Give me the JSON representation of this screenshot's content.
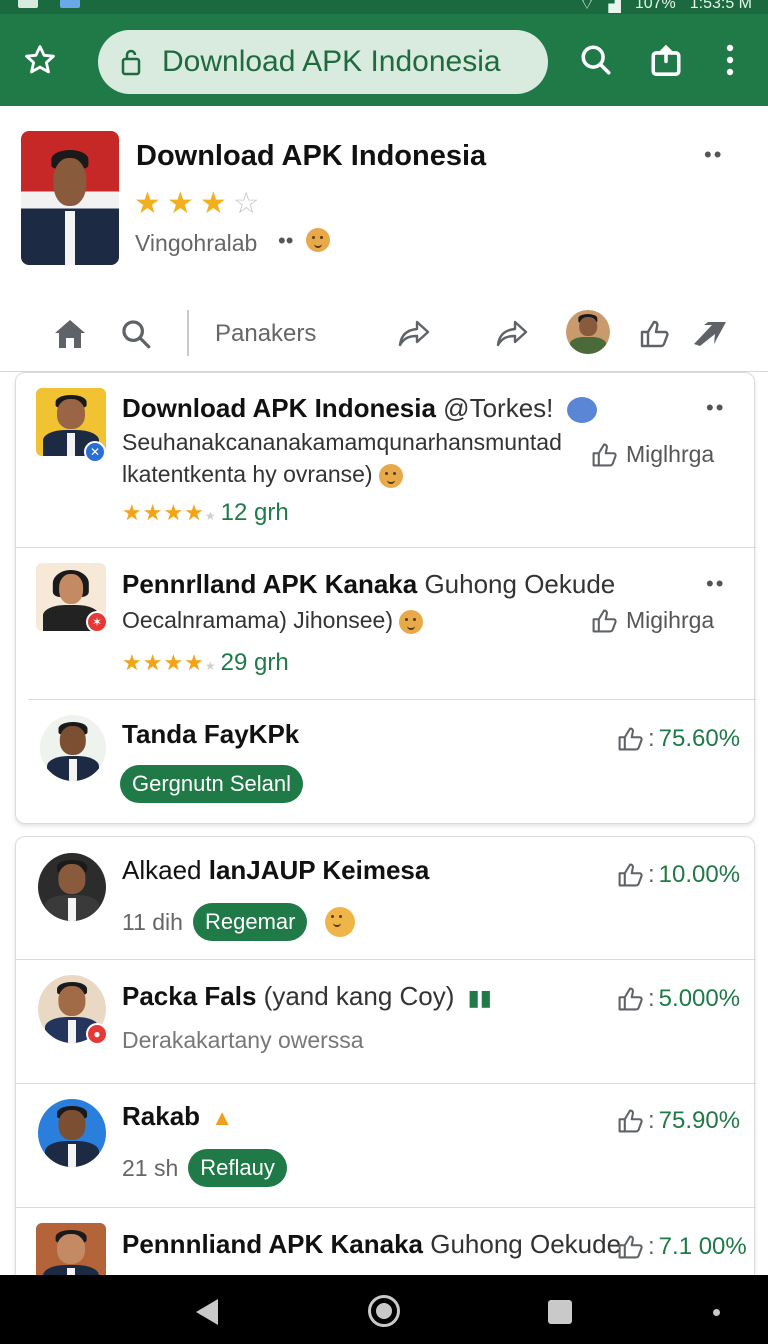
{
  "status_bar": {
    "battery": "107%",
    "time": "1:53:5 M"
  },
  "toolbar": {
    "url": "Download APK Indonesia"
  },
  "app": {
    "title": "Download APK Indonesia",
    "rating": 3,
    "rating_max": 4,
    "developer": "Vingohralab",
    "dots": "••",
    "more": "••"
  },
  "actionbar": {
    "label": "Panakers"
  },
  "items": [
    {
      "title": "Download APK Indonesia",
      "title_extra": " @Torkes!",
      "line1": "Seuhanakcananakamamqunarhansmuntad",
      "line2": "lkatentkenta hy ovranse)",
      "stars": "★★★★",
      "count": "12 grh",
      "action": "Miglhrga",
      "more": "••"
    },
    {
      "title": "Pennrlland APK Kanaka",
      "title_extra": " Guhong Oekude",
      "line1": "Oecalnramama) Jihonsee)",
      "stars": "★★★★",
      "count": "29 grh",
      "action": "Migihrga",
      "more": "••"
    },
    {
      "title": "Tanda FayKPk",
      "pill": "Gergnutn Selanl",
      "pct": "75.60%"
    },
    {
      "title_light": "Alkaed",
      "title": " lanJAUP Keimesa",
      "meta": "11 dih",
      "pill": "Regemar",
      "pct": "10.00%"
    },
    {
      "title": "Packa Fals",
      "title_extra": " (yand kang Coy)",
      "line1": "Derakakartany owerssa",
      "pct": "5.000%"
    },
    {
      "title": "Rakab",
      "meta": "21 sh",
      "pill": "Reflauy",
      "pct": "75.90%"
    },
    {
      "title": "Pennnliand APK Kanaka",
      "title_extra": " Guhong Oekude",
      "pct": "7.1 00%"
    }
  ],
  "colors": {
    "brand": "#1f7a48",
    "star": "#f2b01e"
  }
}
